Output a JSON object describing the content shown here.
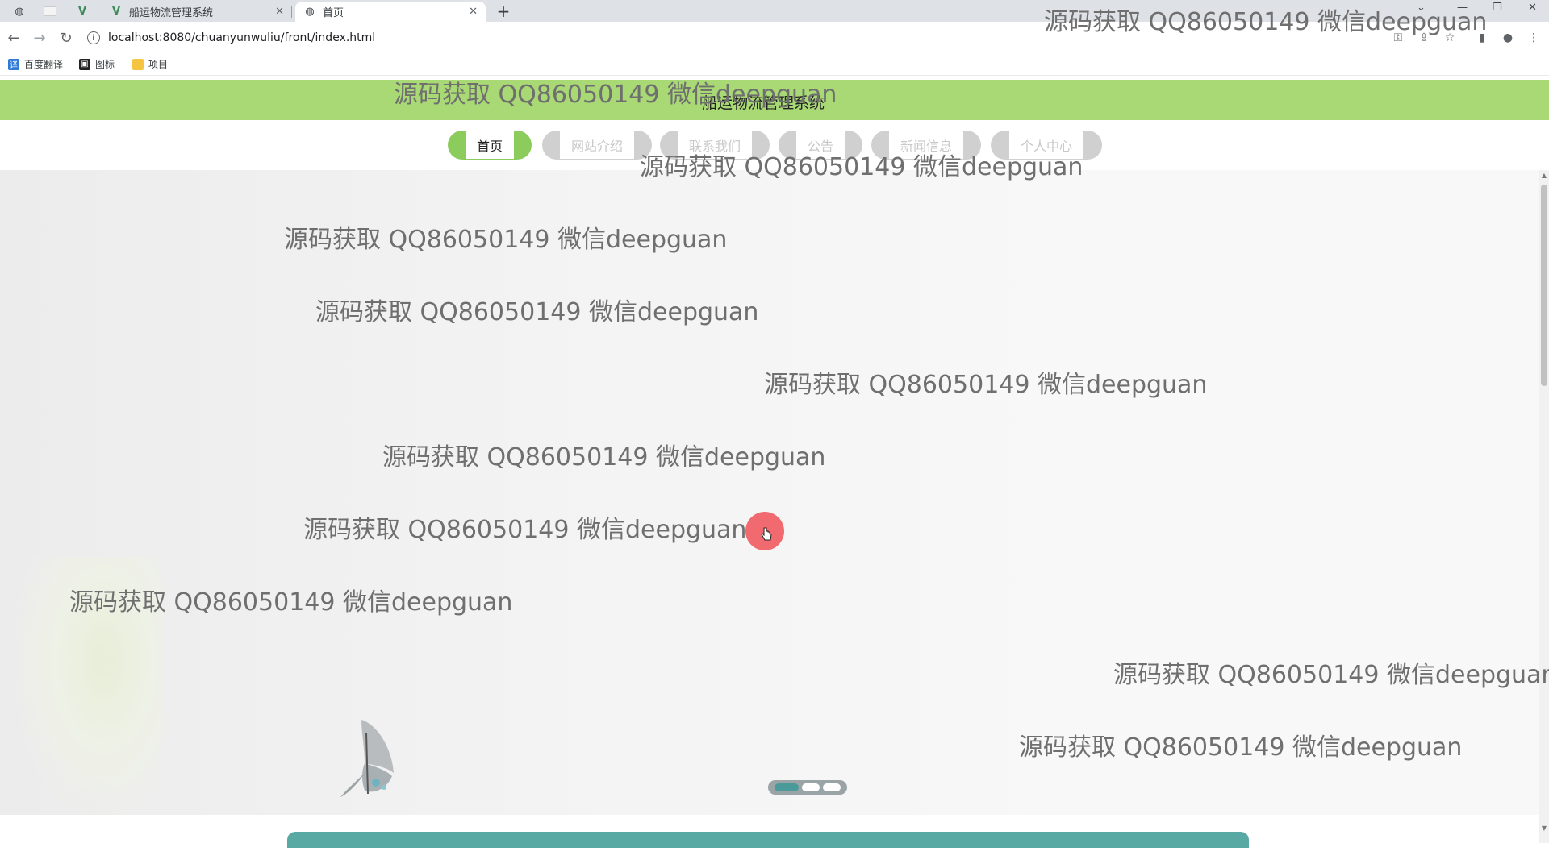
{
  "browser": {
    "tabs": [
      {
        "title": "船运物流管理系统",
        "active": false
      },
      {
        "title": "首页",
        "active": true
      }
    ],
    "new_tab": "+",
    "url": "localhost:8080/chuanyunwuliu/front/index.html",
    "bookmarks": [
      {
        "label": "百度翻译",
        "icon": "translate-icon"
      },
      {
        "label": "图标",
        "icon": "image-icon"
      },
      {
        "label": "项目",
        "icon": "folder-icon"
      }
    ]
  },
  "site": {
    "title": "船运物流管理系统",
    "nav": [
      {
        "label": "首页",
        "active": true
      },
      {
        "label": "网站介绍",
        "active": false
      },
      {
        "label": "联系我们",
        "active": false
      },
      {
        "label": "公告",
        "active": false
      },
      {
        "label": "新闻信息",
        "active": false
      },
      {
        "label": "个人中心",
        "active": false
      }
    ]
  },
  "carousel": {
    "slides": 3,
    "active_index": 0
  },
  "watermark": {
    "text": "源码获取 QQ86050149 微信deepguan"
  },
  "colors": {
    "header_green": "#a8d975",
    "nav_active": "#8ccc5c",
    "teal": "#58a8a4",
    "cursor_highlight": "#f06a6f"
  }
}
